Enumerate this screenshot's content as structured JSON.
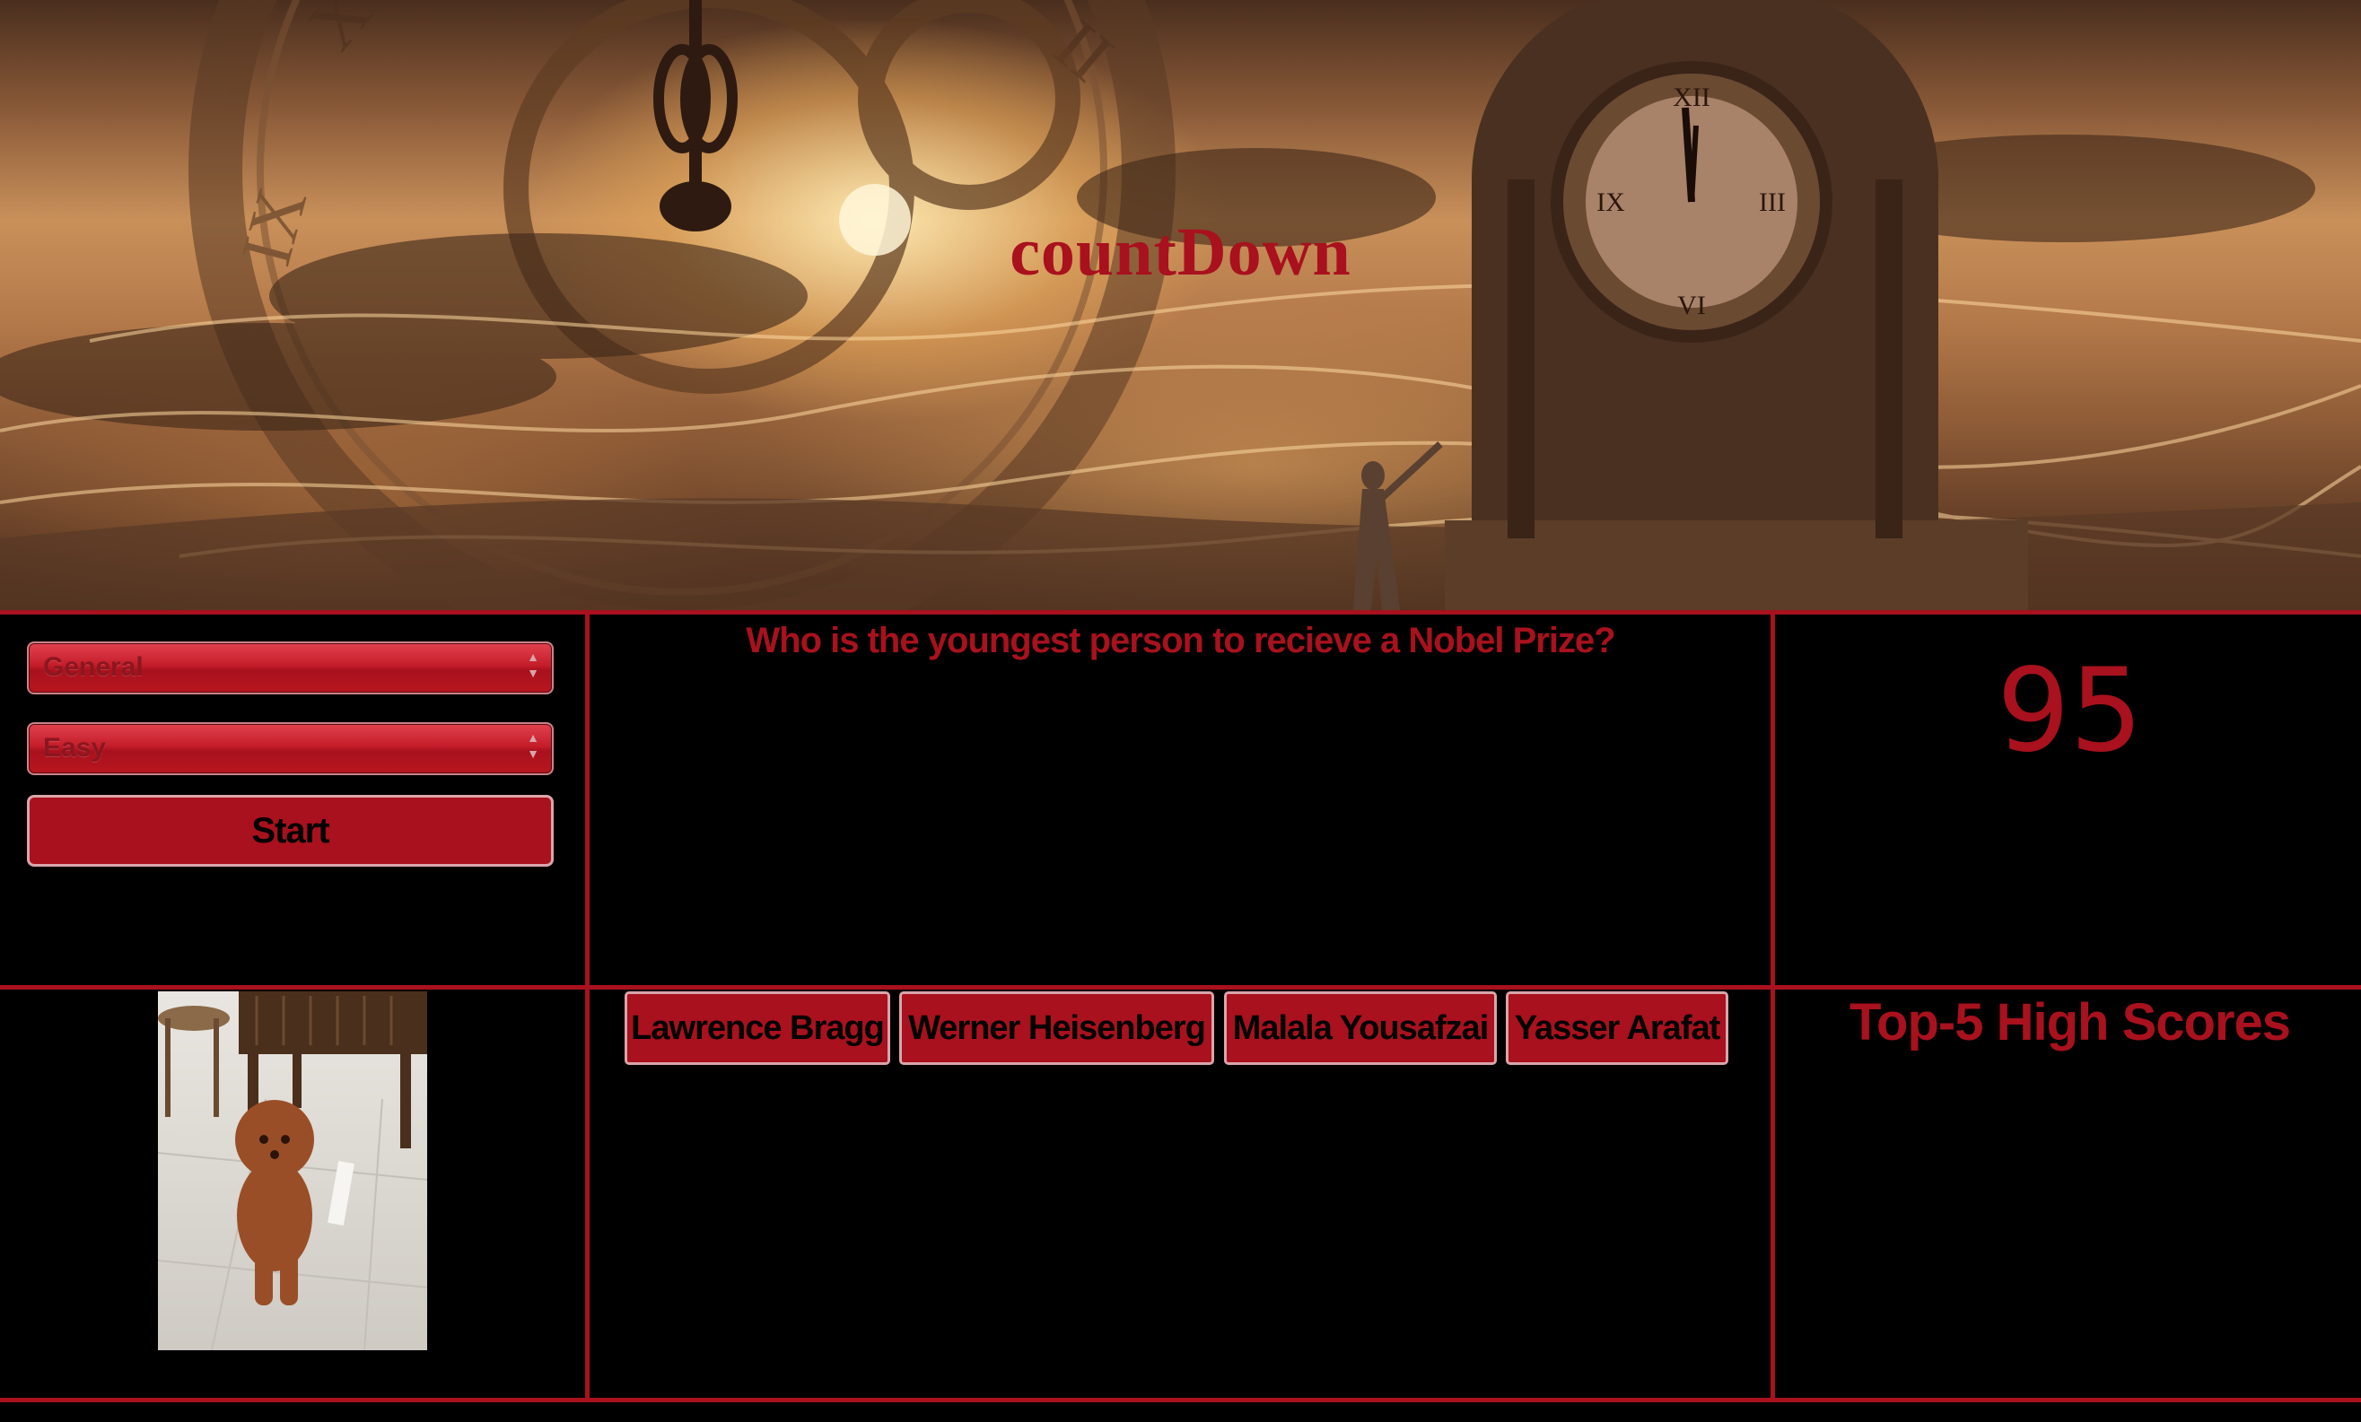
{
  "app": {
    "title": "countDown"
  },
  "controls": {
    "category_select": {
      "selected": "General"
    },
    "difficulty_select": {
      "selected": "Easy"
    },
    "start_label": "Start"
  },
  "question": {
    "text": "Who is the youngest person to recieve a Nobel Prize?"
  },
  "timer": {
    "value": "95"
  },
  "answers": [
    {
      "label": "Lawrence Bragg"
    },
    {
      "label": "Werner Heisenberg"
    },
    {
      "label": "Malala Yousafzai"
    },
    {
      "label": "Yasser Arafat"
    }
  ],
  "highscores": {
    "title": "Top-5 High Scores"
  },
  "colors": {
    "accent": "#a8111d",
    "background": "#000000",
    "button_border": "#d9a5aa"
  }
}
